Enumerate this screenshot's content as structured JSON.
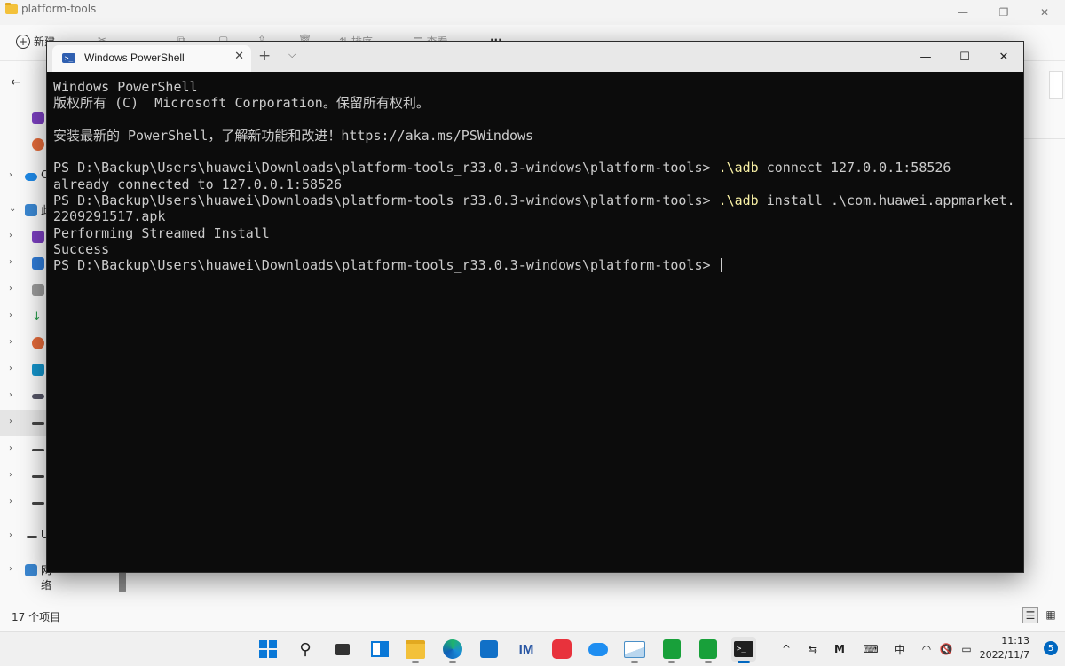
{
  "explorer": {
    "title": "platform-tools",
    "toolbar": {
      "new_label": "新建",
      "sort_label": "排序",
      "view_label": "查看",
      "more_label": "···"
    },
    "sidebar": {
      "onedrive_label": "C",
      "thispc_label": "此",
      "usb_label": "U",
      "network_label": "网络"
    },
    "status": {
      "item_count": "17 个项目"
    }
  },
  "terminal": {
    "tab_title": "Windows PowerShell",
    "lines": [
      {
        "text": "Windows PowerShell"
      },
      {
        "text": "版权所有 (C)  Microsoft Corporation。保留所有权利。"
      },
      {
        "text": ""
      },
      {
        "text": "安装最新的 PowerShell，了解新功能和改进！https://aka.ms/PSWindows"
      },
      {
        "text": ""
      },
      {
        "prompt": "PS D:\\Backup\\Users\\huawei\\Downloads\\platform-tools_r33.0.3-windows\\platform-tools> ",
        "cmd": ".\\adb",
        "args": " connect 127.0.0.1:58526"
      },
      {
        "text": "already connected to 127.0.0.1:58526"
      },
      {
        "prompt": "PS D:\\Backup\\Users\\huawei\\Downloads\\platform-tools_r33.0.3-windows\\platform-tools> ",
        "cmd": ".\\adb",
        "args": " install .\\com.huawei.appmarket."
      },
      {
        "text": "2209291517.apk"
      },
      {
        "text": "Performing Streamed Install"
      },
      {
        "text": "Success"
      },
      {
        "prompt": "PS D:\\Backup\\Users\\huawei\\Downloads\\platform-tools_r33.0.3-windows\\platform-tools> ",
        "cmd": "",
        "args": "",
        "cursor": true
      }
    ]
  },
  "taskbar": {
    "tray": {
      "input_method": "中"
    },
    "clock": {
      "time": "11:13",
      "date": "2022/11/7"
    },
    "notification_count": "5"
  },
  "colors": {
    "terminal_bg": "#0c0c0c",
    "terminal_fg": "#cccccc",
    "command_yellow": "#f9f1a5",
    "accent": "#0067c0"
  },
  "icons": {
    "taskbar_apps": [
      "start-icon",
      "search-icon",
      "task-view-icon",
      "widgets-icon",
      "file-explorer-icon",
      "edge-icon",
      "store-icon",
      "word-icon",
      "huawei-appgallery-icon",
      "cloud-icon",
      "photo-icon",
      "green-app-icon",
      "green-app-2-icon",
      "terminal-icon"
    ]
  }
}
